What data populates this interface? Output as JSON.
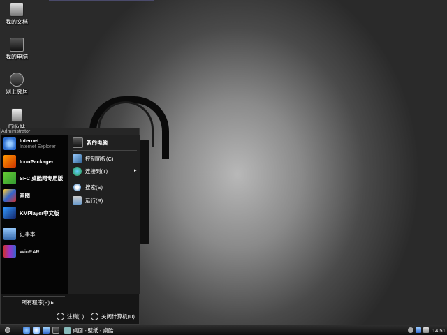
{
  "desktop": {
    "icons": [
      {
        "label": "我的文档",
        "icon": "documents-icon"
      },
      {
        "label": "我的电脑",
        "icon": "computer-icon"
      },
      {
        "label": "网上邻居",
        "icon": "network-icon"
      },
      {
        "label": "回收站",
        "icon": "recycle-bin-icon"
      }
    ]
  },
  "start_menu": {
    "user_name": "Administrator",
    "pinned": [
      {
        "title": "Internet",
        "subtitle": "Internet Explorer",
        "icon": "internet-explorer-icon"
      },
      {
        "title": "IconPackager",
        "icon": "iconpackager-icon"
      },
      {
        "title": "SFC 桌酷网专用版",
        "icon": "sfc-icon"
      },
      {
        "title": "画图",
        "icon": "paint-icon"
      },
      {
        "title": "KMPlayer中文版",
        "icon": "kmplayer-icon"
      }
    ],
    "recent": [
      {
        "title": "记事本",
        "icon": "notepad-icon"
      },
      {
        "title": "WinRAR",
        "icon": "winrar-icon"
      }
    ],
    "all_programs_label": "所有程序(P)",
    "right": [
      {
        "label": "我的电脑",
        "icon": "computer-icon"
      },
      {
        "label": "控制面板(C)",
        "icon": "control-panel-icon"
      },
      {
        "label": "连接到(T)",
        "icon": "connect-icon"
      },
      {
        "label": "搜索(S)",
        "icon": "search-icon"
      },
      {
        "label": "运行(R)...",
        "icon": "run-icon"
      }
    ],
    "logoff_label": "注销(L)",
    "shutdown_label": "关闭计算机(U)"
  },
  "taskbar": {
    "task_label": "桌面 - 壁纸 - 桌酷...",
    "clock": "14:51"
  },
  "colors": {
    "ie_blue": "#2e6fd0",
    "menu_bg": "#050505",
    "panel_bg": "#202020"
  }
}
